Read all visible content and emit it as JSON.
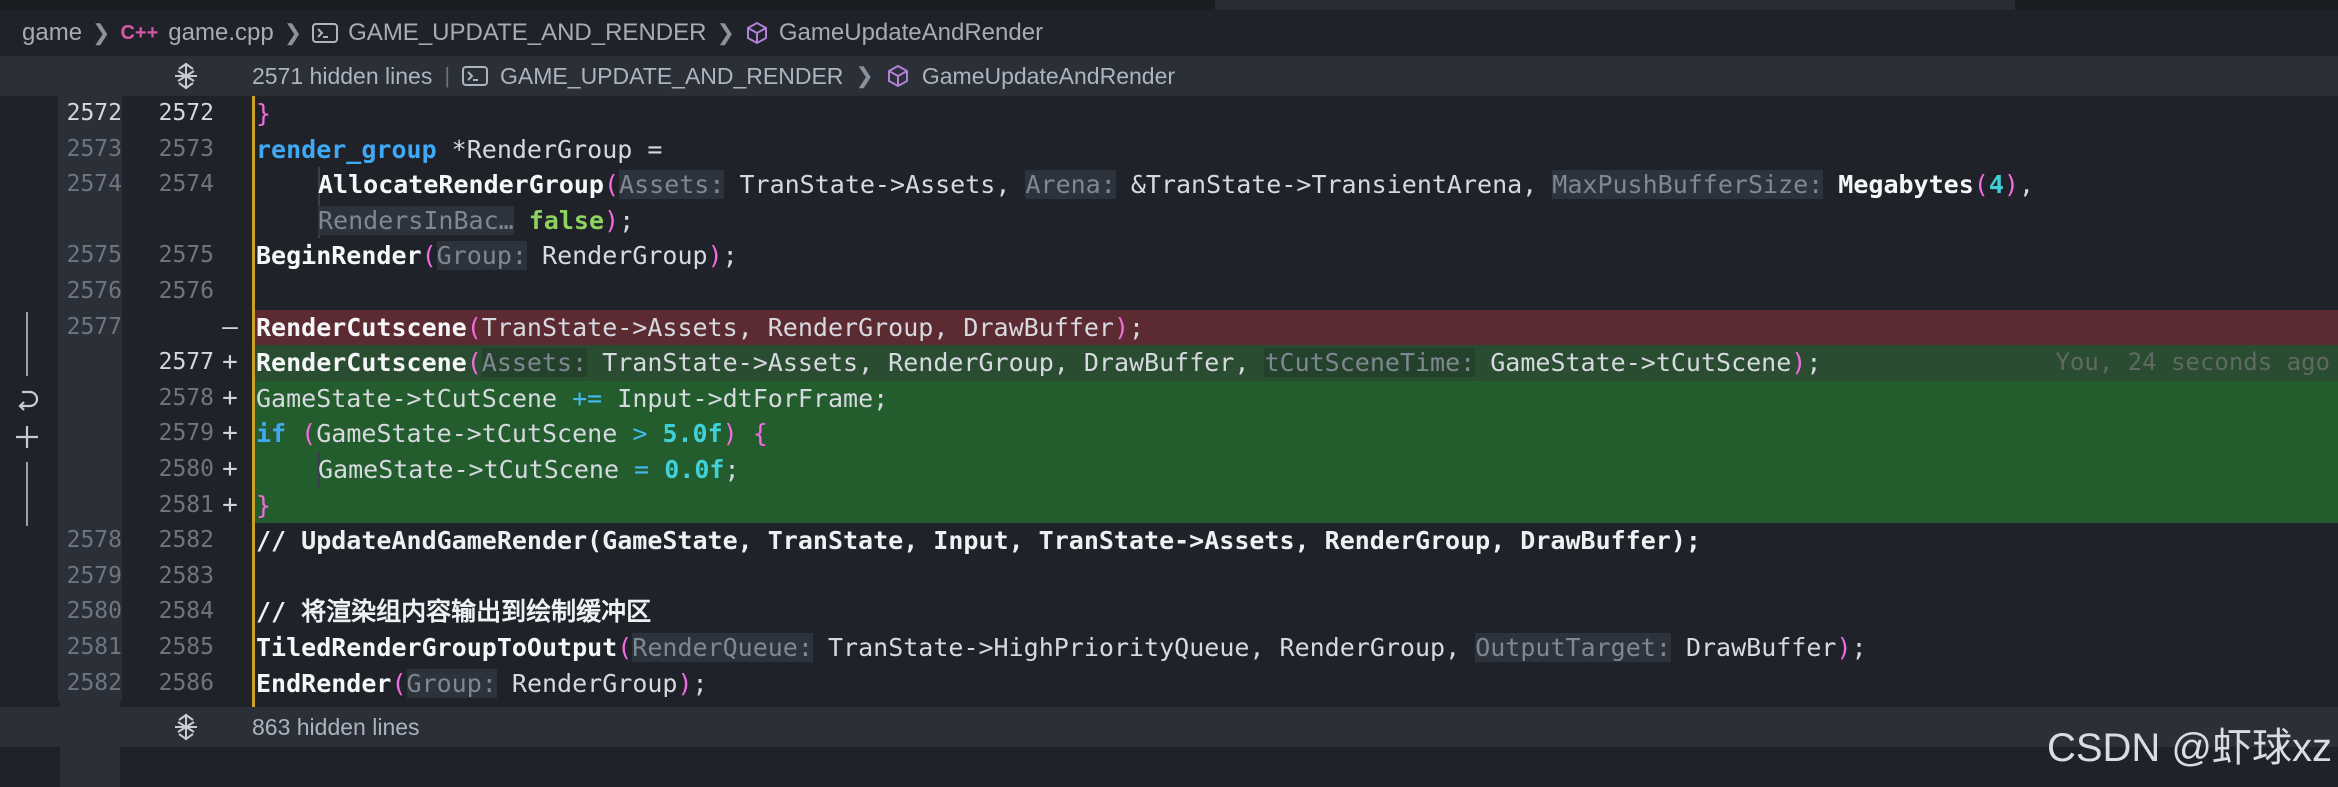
{
  "breadcrumb": {
    "folder": "game",
    "file": "game.cpp",
    "file_icon_text": "C++",
    "macro": "GAME_UPDATE_AND_RENDER",
    "function": "GameUpdateAndRender"
  },
  "hidden_top": {
    "label": "2571 hidden lines",
    "macro": "GAME_UPDATE_AND_RENDER",
    "function": "GameUpdateAndRender"
  },
  "hidden_bottom": {
    "label": "863 hidden lines"
  },
  "lines": [
    {
      "old": "2572",
      "new": "2572",
      "mark": ""
    },
    {
      "old": "2573",
      "new": "2573",
      "mark": ""
    },
    {
      "old": "2574",
      "new": "2574",
      "mark": ""
    },
    {
      "old": "",
      "new": "",
      "mark": ""
    },
    {
      "old": "2575",
      "new": "2575",
      "mark": ""
    },
    {
      "old": "2576",
      "new": "2576",
      "mark": ""
    },
    {
      "old": "2577",
      "new": "",
      "mark": "—"
    },
    {
      "old": "",
      "new": "2577",
      "mark": "+"
    },
    {
      "old": "",
      "new": "2578",
      "mark": "+"
    },
    {
      "old": "",
      "new": "2579",
      "mark": "+"
    },
    {
      "old": "",
      "new": "2580",
      "mark": "+"
    },
    {
      "old": "",
      "new": "2581",
      "mark": "+"
    },
    {
      "old": "2578",
      "new": "2582",
      "mark": ""
    },
    {
      "old": "2579",
      "new": "2583",
      "mark": ""
    },
    {
      "old": "2580",
      "new": "2584",
      "mark": ""
    },
    {
      "old": "2581",
      "new": "2585",
      "mark": ""
    },
    {
      "old": "2582",
      "new": "2586",
      "mark": ""
    }
  ],
  "code": {
    "l0_brace": "}",
    "l1_type": "render_group",
    "l1_rest": " *RenderGroup =",
    "l1_star": "*",
    "l2_fn": "AllocateRenderGroup",
    "l2_h1": "Assets:",
    "l2_a1": "TranState->Assets,",
    "l2_h2": "Arena:",
    "l2_a2": "&TranState->TransientArena,",
    "l2_h3": "MaxPushBufferSize:",
    "l2_fn2": "Megabytes",
    "l2_num": "4",
    "l3_h": "RendersInBac…",
    "l3_bool": "false",
    "l4_fn": "BeginRender",
    "l4_h": "Group:",
    "l4_a": "RenderGroup",
    "l6_fn": "RenderCutscene",
    "l6_args": "TranState->Assets, RenderGroup, DrawBuffer",
    "l7_fn": "RenderCutscene",
    "l7_h1": "Assets:",
    "l7_a1": "TranState->Assets, RenderGroup, DrawBuffer",
    "l7_h2": "tCutSceneTime:",
    "l7_a2": "GameState->tCutScene",
    "l7_blame": "You, 24 seconds ago",
    "l8_a": "GameState->tCutScene",
    "l8_op": "+=",
    "l8_b": "Input->dtForFrame;",
    "l9_kw": "if",
    "l9_a": "GameState->tCutScene",
    "l9_op": ">",
    "l9_num": "5.0",
    "l9_suf": "f",
    "l9_brace": "{",
    "l10_a": "GameState->tCutScene",
    "l10_op": "=",
    "l10_num": "0.0",
    "l10_suf": "f",
    "l11_brace": "}",
    "l12_comment": "// UpdateAndGameRender(GameState, TranState, Input, TranState->Assets, RenderGroup, DrawBuffer);",
    "l14_comment": "// 将渲染组内容输出到绘制缓冲区",
    "l15_fn": "TiledRenderGroupToOutput",
    "l15_h1": "RenderQueue:",
    "l15_a1": "TranState->HighPriorityQueue, RenderGroup,",
    "l15_h2": "OutputTarget:",
    "l15_a2": "DrawBuffer",
    "l16_fn": "EndRender",
    "l16_h": "Group:",
    "l16_a": "RenderGroup"
  },
  "watermark": "CSDN @虾球xz",
  "colors": {
    "deleted_bg": "#5c2b31",
    "inserted_bg": "#245d2d",
    "keyword": "#3fa9f5",
    "number": "#3fd0d9",
    "paren": "#f26be0",
    "guide": "#c9a227"
  },
  "icons": [
    "cpp-file-icon",
    "macro-icon",
    "method-cube-icon",
    "unfold-icon",
    "revert-icon",
    "plus-icon"
  ]
}
